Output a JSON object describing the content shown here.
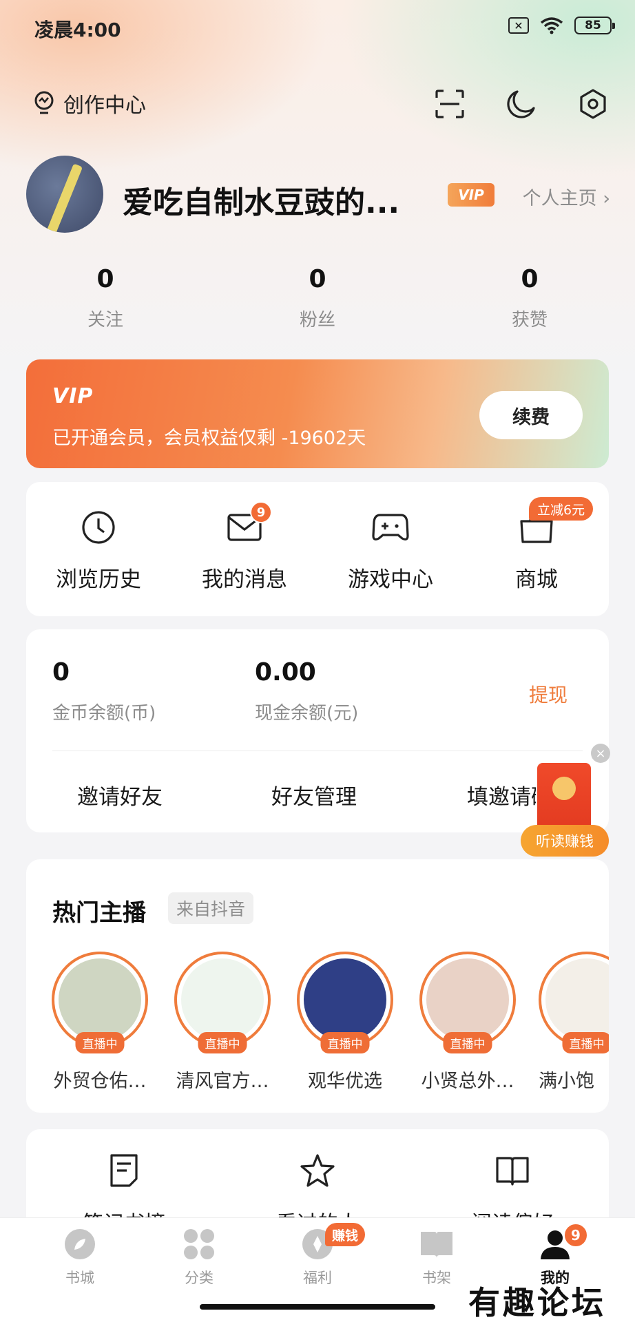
{
  "status_bar": {
    "time": "凌晨4:00",
    "battery": "85",
    "sim": "✕"
  },
  "header": {
    "creator_label": "创作中心"
  },
  "profile": {
    "username": "爱吃自制水豆豉的...",
    "vip_badge": "VIP",
    "homepage_link": "个人主页 ›"
  },
  "stats": [
    {
      "value": "0",
      "label": "关注"
    },
    {
      "value": "0",
      "label": "粉丝"
    },
    {
      "value": "0",
      "label": "获赞"
    }
  ],
  "vip_card": {
    "logo": "VIP",
    "text": "已开通会员，会员权益仅剩 -19602天",
    "button": "续费"
  },
  "menu": [
    {
      "label": "浏览历史",
      "icon": "clock-icon"
    },
    {
      "label": "我的消息",
      "icon": "mail-icon",
      "badge": "9"
    },
    {
      "label": "游戏中心",
      "icon": "gamepad-icon"
    },
    {
      "label": "商城",
      "icon": "shop-bag-icon",
      "badge": "立减6元"
    }
  ],
  "wallet": {
    "coins_value": "0",
    "coins_label": "金币余额(币)",
    "cash_value": "0.00",
    "cash_label": "现金余额(元)",
    "withdraw": "提现",
    "invite": [
      "邀请好友",
      "好友管理",
      "填邀请码"
    ]
  },
  "float_envelope": {
    "label": "听读赚钱",
    "close": "×"
  },
  "hot_streamers": {
    "title": "热门主播",
    "tag": "来自抖音",
    "live_label": "直播中",
    "items": [
      {
        "name": "外贸仓佑…",
        "color": "#cfd6c2"
      },
      {
        "name": "清风官方…",
        "color": "#eef5ee"
      },
      {
        "name": "观华优选",
        "color": "#2f3f86"
      },
      {
        "name": "小贤总外…",
        "color": "#e9d2c6"
      },
      {
        "name": "满小饱",
        "color": "#f3efe8"
      }
    ]
  },
  "tools": [
    {
      "label": "笔记书摘",
      "icon": "note-icon"
    },
    {
      "label": "看过的人",
      "icon": "star-icon"
    },
    {
      "label": "阅读偏好",
      "icon": "book-open-icon"
    }
  ],
  "tabbar": {
    "tabs": [
      {
        "label": "书城",
        "icon": "compass-icon"
      },
      {
        "label": "分类",
        "icon": "grid-icon"
      },
      {
        "label": "福利",
        "icon": "gift-icon"
      },
      {
        "label": "书架",
        "icon": "bookshelf-icon"
      },
      {
        "label": "我的",
        "icon": "user-icon"
      }
    ],
    "earn_badge": "赚钱",
    "me_badge": "9"
  },
  "watermark": "有趣论坛",
  "colors": {
    "accent": "#f26b35",
    "orange_text": "#ef7c3c"
  }
}
